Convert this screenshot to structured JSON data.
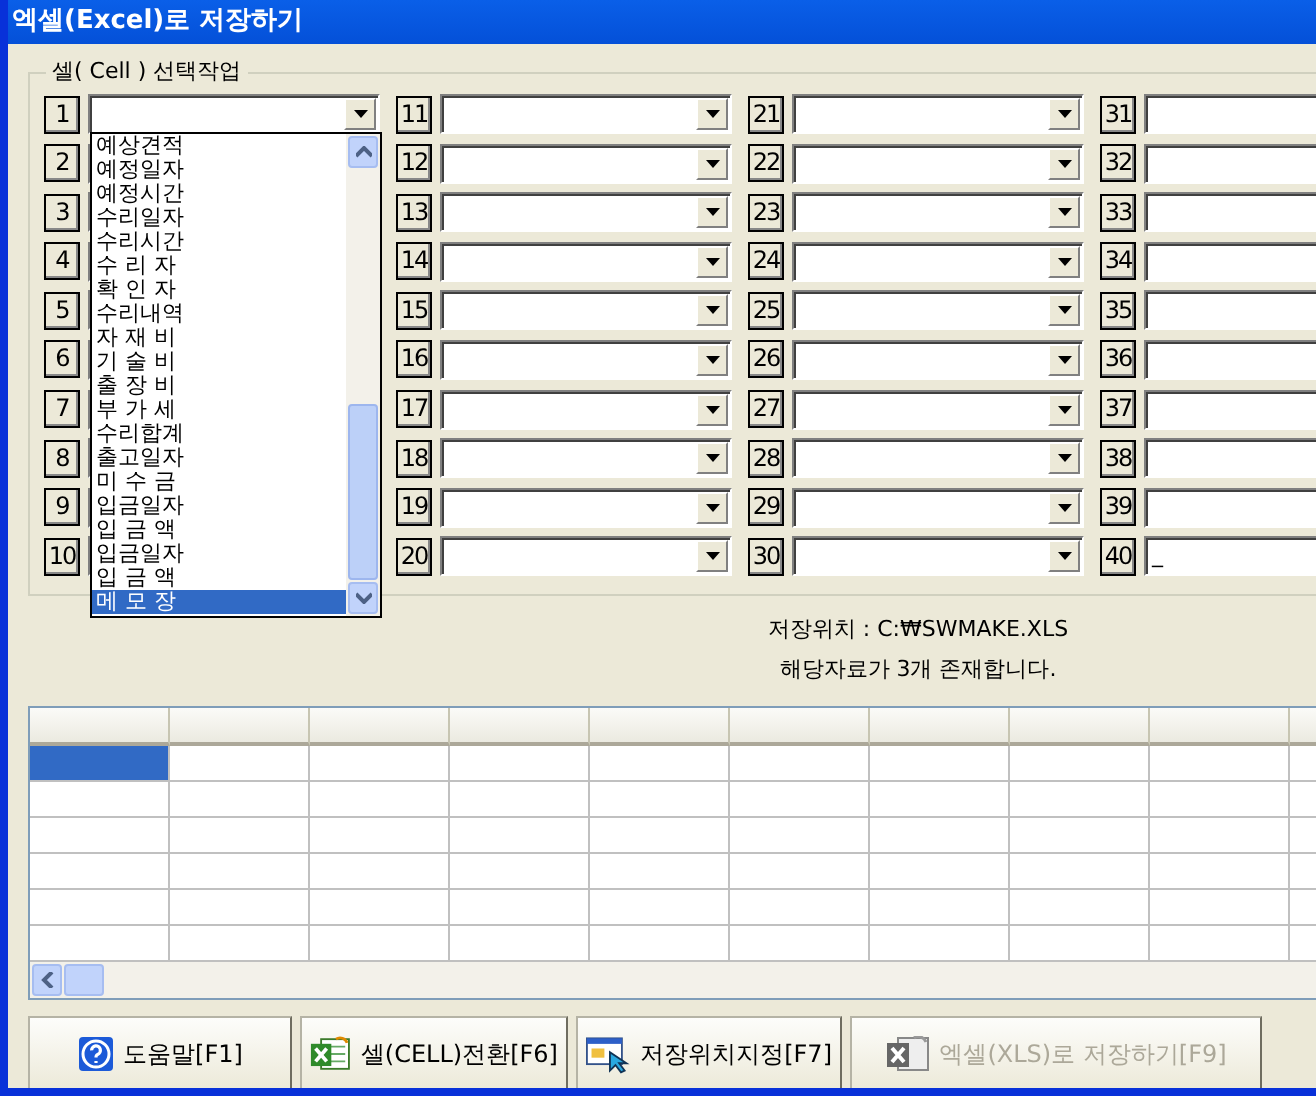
{
  "window": {
    "title": "엑셀(Excel)로 저장하기"
  },
  "group": {
    "title": "셀( Cell ) 선택작업"
  },
  "fields": [
    {
      "number": "1",
      "dropdown": {
        "items": [
          {
            "label": "예상견적",
            "selected": false
          },
          {
            "label": "예정일자",
            "selected": false
          },
          {
            "label": "예정시간",
            "selected": false
          },
          {
            "label": "수리일자",
            "selected": false
          },
          {
            "label": "수리시간",
            "selected": false
          },
          {
            "label": "수 리 자",
            "selected": false
          },
          {
            "label": "확 인 자",
            "selected": false
          },
          {
            "label": "수리내역",
            "selected": false
          },
          {
            "label": "자 재 비",
            "selected": false
          },
          {
            "label": "기 술 비",
            "selected": false
          },
          {
            "label": "출 장 비",
            "selected": false
          },
          {
            "label": "부 가 세",
            "selected": false
          },
          {
            "label": "수리합계",
            "selected": false
          },
          {
            "label": "출고일자",
            "selected": false
          },
          {
            "label": "미 수 금",
            "selected": false
          },
          {
            "label": "입금일자",
            "selected": false
          },
          {
            "label": "입 금 액",
            "selected": false
          },
          {
            "label": "입금일자",
            "selected": false
          },
          {
            "label": "입 금 액",
            "selected": false
          },
          {
            "label": "메 모 장",
            "selected": true
          }
        ]
      }
    },
    {
      "number": "2"
    },
    {
      "number": "3"
    },
    {
      "number": "4"
    },
    {
      "number": "5"
    },
    {
      "number": "6"
    },
    {
      "number": "7"
    },
    {
      "number": "8"
    },
    {
      "number": "9"
    },
    {
      "number": "10"
    },
    {
      "number": "11"
    },
    {
      "number": "12"
    },
    {
      "number": "13"
    },
    {
      "number": "14"
    },
    {
      "number": "15"
    },
    {
      "number": "16"
    },
    {
      "number": "17"
    },
    {
      "number": "18"
    },
    {
      "number": "19"
    },
    {
      "number": "20"
    },
    {
      "number": "21"
    },
    {
      "number": "22"
    },
    {
      "number": "23"
    },
    {
      "number": "24"
    },
    {
      "number": "25"
    },
    {
      "number": "26"
    },
    {
      "number": "27"
    },
    {
      "number": "28"
    },
    {
      "number": "29"
    },
    {
      "number": "30"
    },
    {
      "number": "31"
    },
    {
      "number": "32"
    },
    {
      "number": "33"
    },
    {
      "number": "34"
    },
    {
      "number": "35"
    },
    {
      "number": "36"
    },
    {
      "number": "37"
    },
    {
      "number": "38"
    },
    {
      "number": "39"
    },
    {
      "number": "40",
      "value": "_"
    }
  ],
  "info": {
    "location": "저장위치 : C:₩SWMAKE.XLS",
    "count": "해당자료가 3개 존재합니다."
  },
  "grid": {
    "rows": [
      {
        "selected": true
      },
      {
        "selected": false
      },
      {
        "selected": false
      },
      {
        "selected": false
      },
      {
        "selected": false
      },
      {
        "selected": false
      }
    ]
  },
  "buttons": [
    {
      "label": "도움말[F1]",
      "kind": "help",
      "disabled": false
    },
    {
      "label": "셀(CELL)전환[F6]",
      "kind": "excel",
      "disabled": false
    },
    {
      "label": "저장위치지정[F7]",
      "kind": "location",
      "disabled": false
    },
    {
      "label": "엑셀(XLS)로 저장하기[F9]",
      "kind": "excel-save",
      "disabled": true
    }
  ]
}
